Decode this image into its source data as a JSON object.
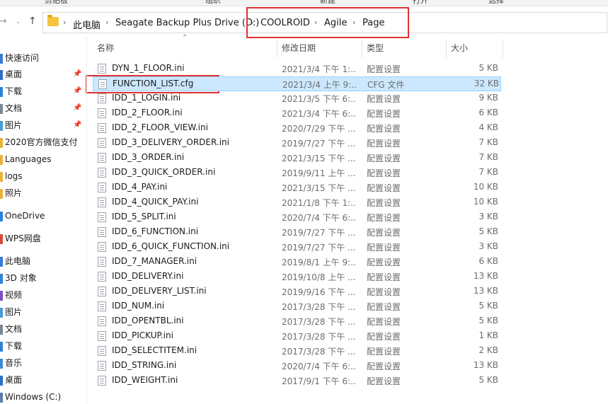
{
  "ribbon": [
    "剪贴板",
    "组织",
    "新建",
    "打开",
    "选择"
  ],
  "address": {
    "crumbs": [
      "此电脑",
      "Seagate Backup Plus Drive (D:)",
      "COOLROID",
      "Agile",
      "Page"
    ]
  },
  "headers": {
    "name": "名称",
    "date": "修改日期",
    "type": "类型",
    "size": "大小"
  },
  "sidebar": [
    {
      "label": "快速访问",
      "pinned": false
    },
    {
      "label": "桌面",
      "pinned": true
    },
    {
      "label": "下载",
      "pinned": true
    },
    {
      "label": "文档",
      "pinned": true
    },
    {
      "label": "图片",
      "pinned": true
    },
    {
      "label": "2020官方微信支付",
      "pinned": false
    },
    {
      "label": "Languages",
      "pinned": false
    },
    {
      "label": "logs",
      "pinned": false
    },
    {
      "label": "照片",
      "pinned": false
    },
    {
      "label": "OneDrive",
      "pinned": false
    },
    {
      "label": "WPS网盘",
      "pinned": false
    },
    {
      "label": "此电脑",
      "pinned": false
    },
    {
      "label": "3D 对象",
      "pinned": false
    },
    {
      "label": "视频",
      "pinned": false
    },
    {
      "label": "图片",
      "pinned": false
    },
    {
      "label": "文档",
      "pinned": false
    },
    {
      "label": "下载",
      "pinned": false
    },
    {
      "label": "音乐",
      "pinned": false
    },
    {
      "label": "桌面",
      "pinned": false
    },
    {
      "label": "Windows (C:)",
      "pinned": false
    }
  ],
  "files": [
    {
      "name": "DYN_1_FLOOR.ini",
      "date": "2021/3/4 下午 1:...",
      "type": "配置设置",
      "size": "5 KB"
    },
    {
      "name": "FUNCTION_LIST.cfg",
      "date": "2021/3/4 上午 9:...",
      "type": "CFG 文件",
      "size": "32 KB",
      "selected": true
    },
    {
      "name": "IDD_1_LOGIN.ini",
      "date": "2021/3/5 下午 6:...",
      "type": "配置设置",
      "size": "9 KB"
    },
    {
      "name": "IDD_2_FLOOR.ini",
      "date": "2021/3/4 下午 6:...",
      "type": "配置设置",
      "size": "6 KB"
    },
    {
      "name": "IDD_2_FLOOR_VIEW.ini",
      "date": "2020/7/29 下午 ...",
      "type": "配置设置",
      "size": "4 KB"
    },
    {
      "name": "IDD_3_DELIVERY_ORDER.ini",
      "date": "2019/7/27 下午 ...",
      "type": "配置设置",
      "size": "7 KB"
    },
    {
      "name": "IDD_3_ORDER.ini",
      "date": "2021/3/15 下午 ...",
      "type": "配置设置",
      "size": "7 KB"
    },
    {
      "name": "IDD_3_QUICK_ORDER.ini",
      "date": "2019/9/11 上午 ...",
      "type": "配置设置",
      "size": "7 KB"
    },
    {
      "name": "IDD_4_PAY.ini",
      "date": "2021/3/15 下午 ...",
      "type": "配置设置",
      "size": "10 KB"
    },
    {
      "name": "IDD_4_QUICK_PAY.ini",
      "date": "2021/1/8 下午 1:...",
      "type": "配置设置",
      "size": "10 KB"
    },
    {
      "name": "IDD_5_SPLIT.ini",
      "date": "2020/7/4 下午 6:...",
      "type": "配置设置",
      "size": "3 KB"
    },
    {
      "name": "IDD_6_FUNCTION.ini",
      "date": "2019/7/27 下午 ...",
      "type": "配置设置",
      "size": "5 KB"
    },
    {
      "name": "IDD_6_QUICK_FUNCTION.ini",
      "date": "2019/7/27 下午 ...",
      "type": "配置设置",
      "size": "3 KB"
    },
    {
      "name": "IDD_7_MANAGER.ini",
      "date": "2019/8/1 上午 9:...",
      "type": "配置设置",
      "size": "6 KB"
    },
    {
      "name": "IDD_DELIVERY.ini",
      "date": "2019/10/8 上午 ...",
      "type": "配置设置",
      "size": "13 KB"
    },
    {
      "name": "IDD_DELIVERY_LIST.ini",
      "date": "2019/9/16 下午 ...",
      "type": "配置设置",
      "size": "13 KB"
    },
    {
      "name": "IDD_NUM.ini",
      "date": "2017/3/28 下午 ...",
      "type": "配置设置",
      "size": "5 KB"
    },
    {
      "name": "IDD_OPENTBL.ini",
      "date": "2017/3/28 下午 ...",
      "type": "配置设置",
      "size": "5 KB"
    },
    {
      "name": "IDD_PICKUP.ini",
      "date": "2017/3/28 下午 ...",
      "type": "配置设置",
      "size": "1 KB"
    },
    {
      "name": "IDD_SELECTITEM.ini",
      "date": "2017/3/28 下午 ...",
      "type": "配置设置",
      "size": "2 KB"
    },
    {
      "name": "IDD_STRING.ini",
      "date": "2020/7/4 下午 6:...",
      "type": "配置设置",
      "size": "13 KB"
    },
    {
      "name": "IDD_WEIGHT.ini",
      "date": "2017/9/1 下午 6:...",
      "type": "配置设置",
      "size": "5 KB"
    }
  ]
}
